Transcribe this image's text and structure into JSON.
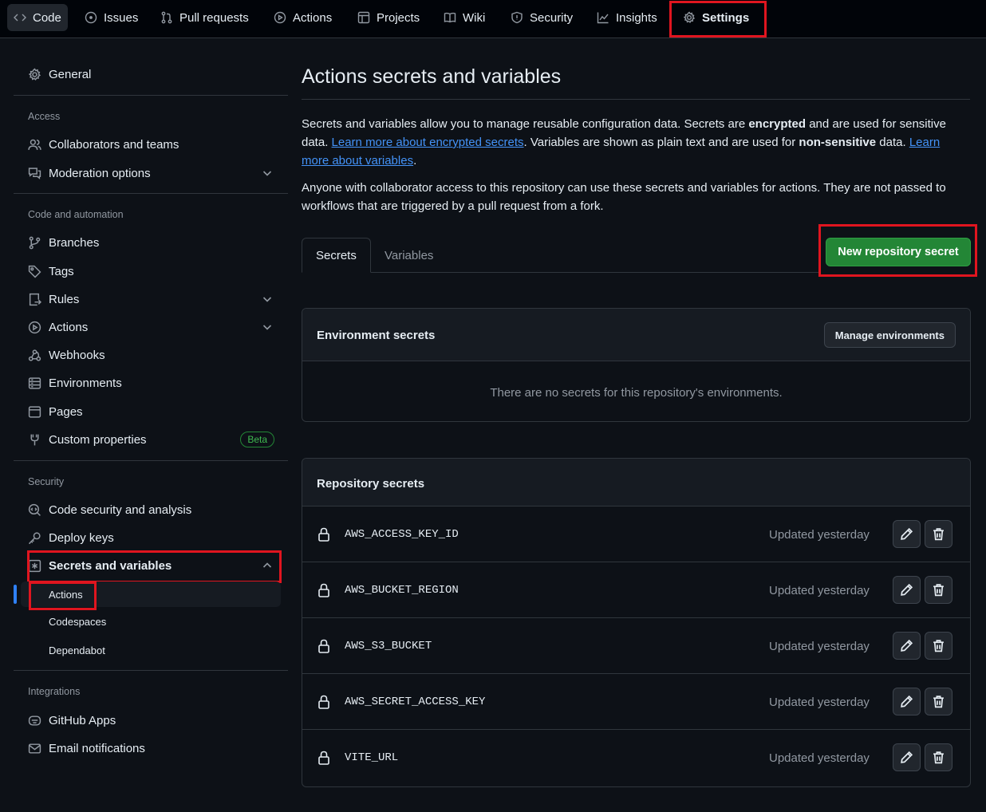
{
  "nav": {
    "code": "Code",
    "issues": "Issues",
    "pulls": "Pull requests",
    "actions": "Actions",
    "projects": "Projects",
    "wiki": "Wiki",
    "security": "Security",
    "insights": "Insights",
    "settings": "Settings"
  },
  "sidebar": {
    "general": "General",
    "access_head": "Access",
    "collaborators": "Collaborators and teams",
    "moderation": "Moderation options",
    "code_head": "Code and automation",
    "branches": "Branches",
    "tags": "Tags",
    "rules": "Rules",
    "actions": "Actions",
    "webhooks": "Webhooks",
    "environments": "Environments",
    "pages": "Pages",
    "custom_props": "Custom properties",
    "beta": "Beta",
    "security_head": "Security",
    "code_security": "Code security and analysis",
    "deploy_keys": "Deploy keys",
    "secrets_vars": "Secrets and variables",
    "sub_actions": "Actions",
    "sub_codespaces": "Codespaces",
    "sub_dependabot": "Dependabot",
    "integrations_head": "Integrations",
    "github_apps": "GitHub Apps",
    "email_notifications": "Email notifications"
  },
  "main": {
    "title": "Actions secrets and variables",
    "p1_a": "Secrets and variables allow you to manage reusable configuration data. Secrets are ",
    "p1_b": "encrypted",
    "p1_c": " and are used for sensitive data. ",
    "p1_link1": "Learn more about encrypted secrets",
    "p1_d": ". Variables are shown as plain text and are used for ",
    "p1_e": "non-sensitive",
    "p1_f": " data. ",
    "p1_link2": "Learn more about variables",
    "p1_g": ".",
    "p2": "Anyone with collaborator access to this repository can use these secrets and variables for actions. They are not passed to workflows that are triggered by a pull request from a fork.",
    "tab_secrets": "Secrets",
    "tab_variables": "Variables",
    "new_secret_btn": "New repository secret",
    "env_title": "Environment secrets",
    "manage_env_btn": "Manage environments",
    "env_empty": "There are no secrets for this repository's environments.",
    "repo_title": "Repository secrets",
    "secrets": [
      {
        "name": "AWS_ACCESS_KEY_ID",
        "updated": "Updated yesterday"
      },
      {
        "name": "AWS_BUCKET_REGION",
        "updated": "Updated yesterday"
      },
      {
        "name": "AWS_S3_BUCKET",
        "updated": "Updated yesterday"
      },
      {
        "name": "AWS_SECRET_ACCESS_KEY",
        "updated": "Updated yesterday"
      },
      {
        "name": "VITE_URL",
        "updated": "Updated yesterday"
      }
    ]
  },
  "colors": {
    "background": "#0d1117",
    "accent_green": "#238636",
    "link_blue": "#4493f8",
    "highlight_red": "#e0151f"
  }
}
